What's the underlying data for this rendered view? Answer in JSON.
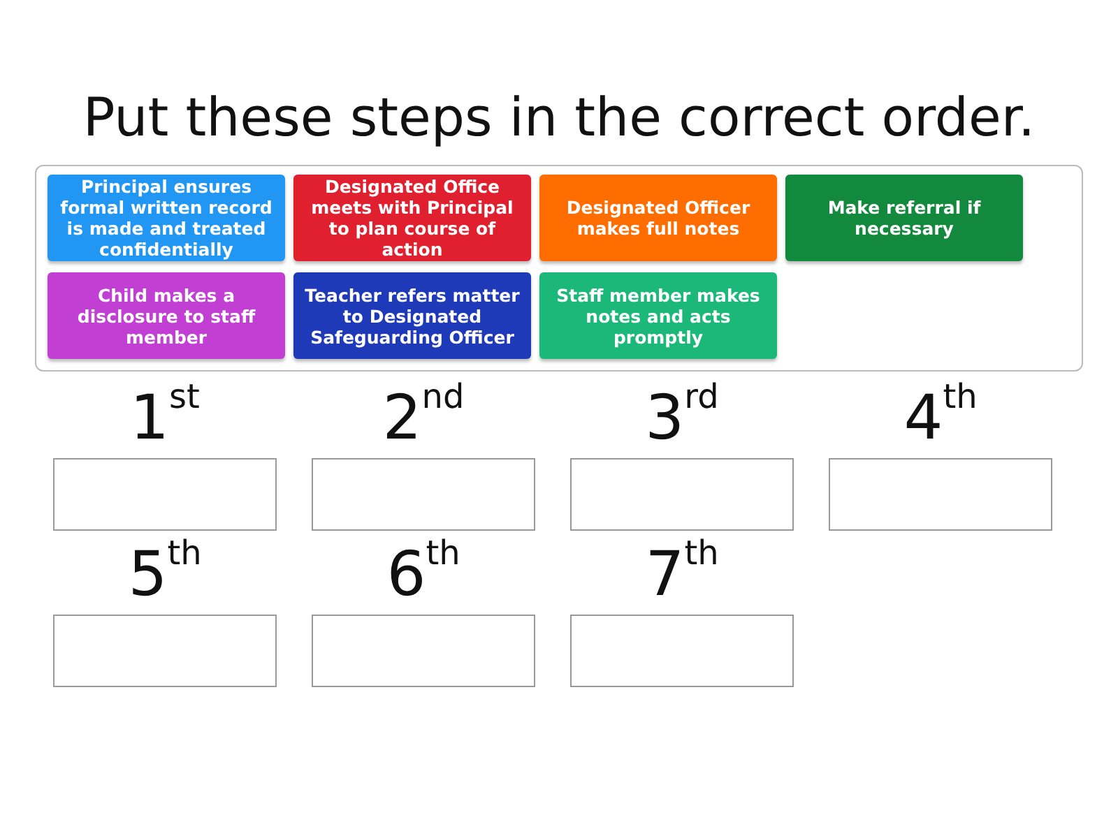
{
  "title": "Put these steps in the correct order.",
  "cards": [
    {
      "text": "Principal ensures formal written record is made and treated confidentially",
      "color": "#2196f3"
    },
    {
      "text": "Designated Office meets with Principal to plan course of action",
      "color": "#e0202f"
    },
    {
      "text": "Designated Officer makes full notes",
      "color": "#ff6d00"
    },
    {
      "text": "Make referral if necessary",
      "color": "#13893d"
    },
    {
      "text": "Child makes a disclosure to staff member",
      "color": "#c23fd4"
    },
    {
      "text": "Teacher refers matter to Designated Safeguarding Officer",
      "color": "#1e3ab8"
    },
    {
      "text": "Staff member makes notes and acts promptly",
      "color": "#1bb87a"
    }
  ],
  "slots": [
    {
      "label": "1$^{st}$"
    },
    {
      "label": "2$^{nd}$"
    },
    {
      "label": "3$^{rd}$"
    },
    {
      "label": "4$^{th}$"
    },
    {
      "label": "5$^{th}$"
    },
    {
      "label": "6$^{th}$"
    },
    {
      "label": "7$^{th}$"
    }
  ]
}
